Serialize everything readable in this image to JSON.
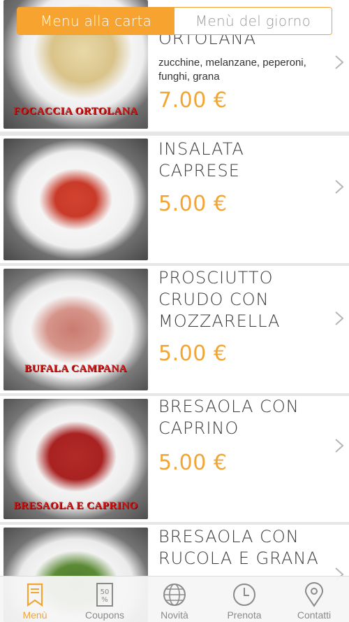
{
  "header": {
    "tabs": [
      {
        "label": "Menu alla carta",
        "active": true
      },
      {
        "label": "Menù del giorno",
        "active": false
      }
    ]
  },
  "items": [
    {
      "name": "ORTOLANA",
      "description": "zucchine, melanzane, peperoni, funghi, grana",
      "price": "7.00 €",
      "image_label": "FOCACCIA ORTOLANA"
    },
    {
      "name": "INSALATA CAPRESE",
      "description": "",
      "price": "5.00 €",
      "image_label": ""
    },
    {
      "name": "PROSCIUTTO CRUDO CON MOZZARELLA",
      "description": "",
      "price": "5.00 €",
      "image_label": "BUFALA CAMPANA"
    },
    {
      "name": "BRESAOLA CON CAPRINO",
      "description": "",
      "price": "5.00 €",
      "image_label": "BRESAOLA E CAPRINO"
    },
    {
      "name": "BRESAOLA CON RUCOLA E GRANA",
      "description": "",
      "price": "",
      "image_label": ""
    }
  ],
  "nav": [
    {
      "label": "Menù",
      "icon": "menu-bookmark-icon",
      "active": true
    },
    {
      "label": "Coupons",
      "icon": "coupon-icon",
      "active": false
    },
    {
      "label": "Novità",
      "icon": "globe-icon",
      "active": false
    },
    {
      "label": "Prenota",
      "icon": "clock-icon",
      "active": false
    },
    {
      "label": "Contatti",
      "icon": "location-pin-icon",
      "active": false
    }
  ],
  "coupon_icon_text": "50 %",
  "colors": {
    "accent": "#f6a330",
    "price": "#f2a533",
    "text": "#3a3a3a"
  }
}
